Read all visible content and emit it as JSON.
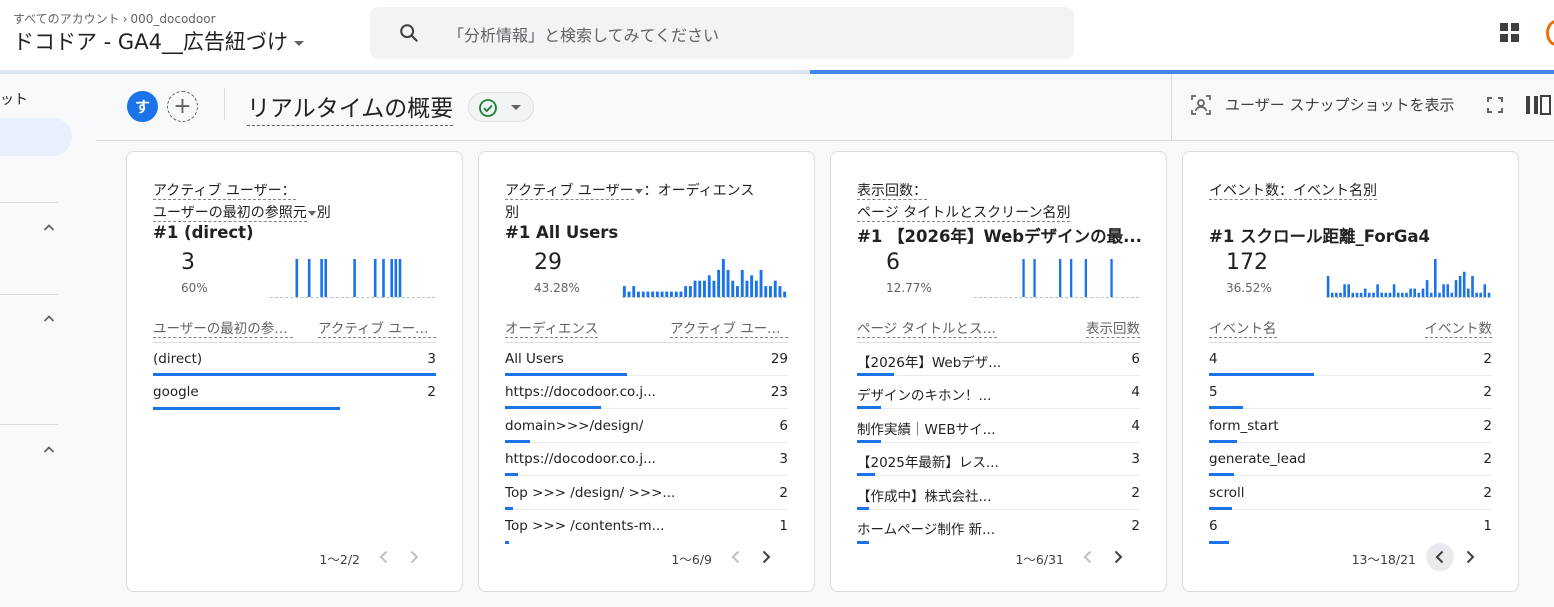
{
  "header": {
    "breadcrumb_all": "すべてのアカウント",
    "breadcrumb_account": "000_docodoor",
    "property": "ドコドア - GA4__広告紐づけ",
    "search_placeholder": "「分析情報」と検索してみてください"
  },
  "sidebar": {
    "truncated_label": "ット"
  },
  "toolbar": {
    "segment_initial": "す",
    "add_segment": "+",
    "page_title": "リアルタイムの概要",
    "snapshot_label": "ユーザー スナップショットを表示"
  },
  "cards": [
    {
      "title1": "アクティブ ユーザー：",
      "title2": "ユーザーの最初の参照元",
      "title2_suffix": "別",
      "rank": "#1  (direct)",
      "value": "3",
      "percent": "60%",
      "spark": [
        0,
        0,
        0,
        0,
        0,
        0,
        1,
        0,
        0,
        1,
        0,
        0,
        1,
        1,
        0,
        0,
        0,
        0,
        0,
        0,
        1,
        0,
        0,
        0,
        0,
        1,
        0,
        1,
        0,
        1,
        1,
        1,
        0,
        0,
        0,
        0,
        0,
        0,
        0,
        0
      ],
      "col1": "ユーザーの最初の参照元",
      "col2": "アクティブ ユーザー",
      "rows": [
        {
          "label": "(direct)",
          "value": "3",
          "bar": 1.0
        },
        {
          "label": "google",
          "value": "2",
          "bar": 0.66
        }
      ],
      "pager": "1〜2/2",
      "prev_active": false
    },
    {
      "title1": "アクティブ ユーザー",
      "title1_suffix": "：オーディエンス",
      "title2": "別",
      "rank": "#1  All Users",
      "value": "29",
      "percent": "43.28%",
      "spark": [
        2,
        1,
        2,
        1,
        1,
        1,
        1,
        1,
        1,
        1,
        1,
        1,
        1,
        2,
        2,
        3,
        3,
        3,
        4,
        3,
        5,
        7,
        5,
        3,
        2,
        5,
        3,
        4,
        3,
        5,
        2,
        2,
        3,
        2,
        1
      ],
      "col1": "オーディエンス",
      "col2": "アクティブ ユーザー",
      "rows": [
        {
          "label": "All Users",
          "value": "29",
          "bar": 0.43
        },
        {
          "label": "https://docodoor.co.j...",
          "value": "23",
          "bar": 0.34
        },
        {
          "label": "domain>>>/design/",
          "value": "6",
          "bar": 0.09
        },
        {
          "label": "https://docodoor.co.j...",
          "value": "3",
          "bar": 0.045
        },
        {
          "label": "Top >>> /design/ >>>...",
          "value": "2",
          "bar": 0.03
        },
        {
          "label": "Top >>> /contents-m...",
          "value": "1",
          "bar": 0.015
        }
      ],
      "pager": "1〜6/9",
      "prev_active": false
    },
    {
      "title1": "表示回数：",
      "title2": "ページ タイトルとスクリーン名別",
      "rank": "#1  【2026年】Webデザインの最...",
      "value": "6",
      "percent": "12.77%",
      "spark": [
        0,
        0,
        0,
        0,
        0,
        0,
        0,
        0,
        0,
        0,
        0,
        0,
        0,
        1,
        0,
        0,
        1,
        0,
        0,
        0,
        0,
        0,
        0,
        1,
        0,
        0,
        1,
        0,
        0,
        0,
        1,
        0,
        0,
        0,
        0,
        0,
        0,
        1,
        0,
        0,
        0,
        0,
        0,
        0,
        0
      ],
      "col1": "ページ タイトルとスクリーン名",
      "col2": "表示回数",
      "rows": [
        {
          "label": "【2026年】Webデザ...",
          "value": "6",
          "bar": 0.13
        },
        {
          "label": "デザインのキホン！...",
          "value": "4",
          "bar": 0.085
        },
        {
          "label": "制作実績｜WEBサイ...",
          "value": "4",
          "bar": 0.085
        },
        {
          "label": "【2025年最新】レス...",
          "value": "3",
          "bar": 0.064
        },
        {
          "label": "【作成中】株式会社...",
          "value": "2",
          "bar": 0.043
        },
        {
          "label": "ホームページ制作 新...",
          "value": "2",
          "bar": 0.043
        }
      ],
      "pager": "1〜6/31",
      "prev_active": false
    },
    {
      "title1": "イベント数",
      "title1_suffix": "：イベント名別",
      "title2": "",
      "rank": "#1  スクロール距離_ForGa4",
      "value": "172",
      "percent": "36.52%",
      "spark": [
        5,
        1,
        1,
        1,
        3,
        3,
        1,
        1,
        1,
        2,
        1,
        1,
        3,
        1,
        1,
        1,
        3,
        1,
        1,
        1,
        2,
        2,
        1,
        2,
        4,
        1,
        9,
        1,
        3,
        3,
        1,
        4,
        5,
        6,
        2,
        5,
        1,
        1,
        3,
        1
      ],
      "col1": "イベント名",
      "col2": "イベント数",
      "rows": [
        {
          "label": "4",
          "value": "2",
          "bar": 0.37
        },
        {
          "label": "5",
          "value": "2",
          "bar": 0.12
        },
        {
          "label": "form_start",
          "value": "2",
          "bar": 0.1
        },
        {
          "label": "generate_lead",
          "value": "2",
          "bar": 0.09
        },
        {
          "label": "scroll",
          "value": "2",
          "bar": 0.08
        },
        {
          "label": "6",
          "value": "1",
          "bar": 0.07
        }
      ],
      "pager": "13〜18/21",
      "prev_active": true
    }
  ],
  "colors": {
    "accent": "#1a73e8",
    "progress": "#4285f4",
    "status_ok": "#188038"
  }
}
